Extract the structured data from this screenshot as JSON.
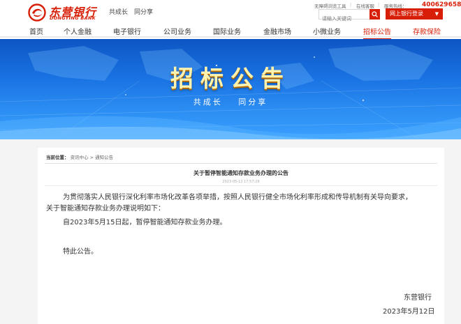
{
  "header": {
    "logo_cn": "东营银行",
    "logo_en": "DONGYING BANK",
    "slogan": "共成长　同分享",
    "accessibility_link": "无障碍浏览工具",
    "online_message_link": "在线客服",
    "phone_label": "服务热线：",
    "phone": "4006296588",
    "search_placeholder": "请输入关键词",
    "ebank_button": "网上银行登录",
    "separator": "|"
  },
  "nav": {
    "items": [
      {
        "label": "首页"
      },
      {
        "label": "个人金融"
      },
      {
        "label": "电子银行"
      },
      {
        "label": "公司业务"
      },
      {
        "label": "国际业务"
      },
      {
        "label": "金融市场"
      },
      {
        "label": "小微业务"
      },
      {
        "label": "招标公告"
      },
      {
        "label": "存款保险"
      }
    ]
  },
  "banner": {
    "title": "招标公告",
    "subtitle_left": "共成长",
    "subtitle_right": "同分享"
  },
  "breadcrumb": {
    "label": "当前位置：",
    "path": "资讯中心 > 通知公告"
  },
  "article": {
    "title": "关于暂停智能通知存款业务办理的公告",
    "date": "2023-05-12 17:57:29",
    "paragraph1_line1": "为贯彻落实人民银行深化利率市场化改革各项举措，按照人民银行健全市场化利率形成和传导机制有关导向要求，",
    "paragraph1_line2": "关于智能通知存款业务办理说明如下：",
    "paragraph2": "自2023年5月15日起，暂停智能通知存款业务办理。",
    "paragraph3": "特此公告。",
    "signature": "东营银行",
    "sign_date": "2023年5月12日"
  },
  "colors": {
    "brand_red": "#d81e06",
    "banner_blue": "#1a73e3",
    "banner_title": "#fff3b0"
  }
}
